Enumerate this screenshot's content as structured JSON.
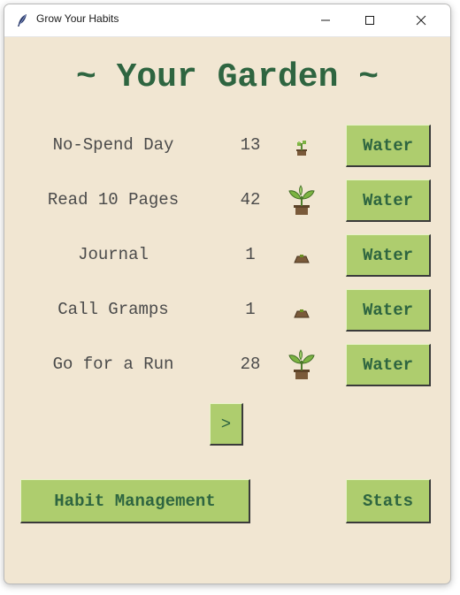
{
  "window": {
    "title": "Grow Your Habits",
    "controls": {
      "minimize": "minimize-icon",
      "maximize": "maximize-icon",
      "close": "close-icon"
    }
  },
  "colors": {
    "background": "#f1e6d2",
    "heading": "#2e6540",
    "button_bg": "#aecd6e",
    "button_text": "#2e6540",
    "label_text": "#4a4a4a"
  },
  "heading": "~ Your Garden ~",
  "habits": [
    {
      "name": "No-Spend Day",
      "count": "13",
      "plant_icon": "small-sprout-icon",
      "button": "Water"
    },
    {
      "name": "Read 10 Pages",
      "count": "42",
      "plant_icon": "potted-plant-icon",
      "button": "Water"
    },
    {
      "name": "Journal",
      "count": "1",
      "plant_icon": "soil-mound-icon",
      "button": "Water"
    },
    {
      "name": "Call Gramps",
      "count": "1",
      "plant_icon": "soil-mound-icon",
      "button": "Water"
    },
    {
      "name": "Go for a Run",
      "count": "28",
      "plant_icon": "potted-plant-icon",
      "button": "Water"
    }
  ],
  "pagination": {
    "next_label": ">"
  },
  "footer": {
    "habit_management_label": "Habit Management",
    "stats_label": "Stats"
  }
}
